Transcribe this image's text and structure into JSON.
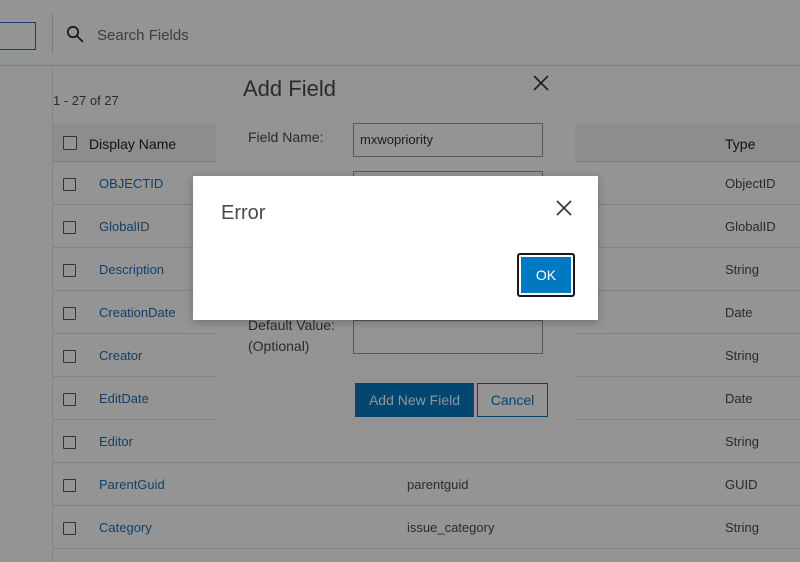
{
  "search": {
    "placeholder": "Search Fields"
  },
  "table": {
    "record_count": "1 - 27 of 27",
    "headers": {
      "display_name": "Display Name",
      "type": "Type"
    },
    "rows": [
      {
        "display_name": "OBJECTID",
        "field_name": "",
        "type": "ObjectID"
      },
      {
        "display_name": "GlobalID",
        "field_name": "",
        "type": "GlobalID"
      },
      {
        "display_name": "Description",
        "field_name": "",
        "type": "String"
      },
      {
        "display_name": "CreationDate",
        "field_name": "",
        "type": "Date"
      },
      {
        "display_name": "Creator",
        "field_name": "",
        "type": "String"
      },
      {
        "display_name": "EditDate",
        "field_name": "",
        "type": "Date"
      },
      {
        "display_name": "Editor",
        "field_name": "",
        "type": "String"
      },
      {
        "display_name": "ParentGuid",
        "field_name": "parentguid",
        "type": "GUID"
      },
      {
        "display_name": "Category",
        "field_name": "issue_category",
        "type": "String"
      }
    ]
  },
  "add_field_dialog": {
    "title": "Add Field",
    "field_name_label": "Field Name:",
    "field_name_value": "mxwopriority",
    "default_value_label": "Default Value:",
    "default_value_optional": "(Optional)",
    "default_value_value": "",
    "add_button": "Add New Field",
    "cancel_button": "Cancel"
  },
  "error_dialog": {
    "title": "Error",
    "ok_button": "OK"
  },
  "colors": {
    "accent": "#0079c1",
    "link": "#1f6fb3",
    "overlay": "rgba(0,0,0,0.42)"
  }
}
